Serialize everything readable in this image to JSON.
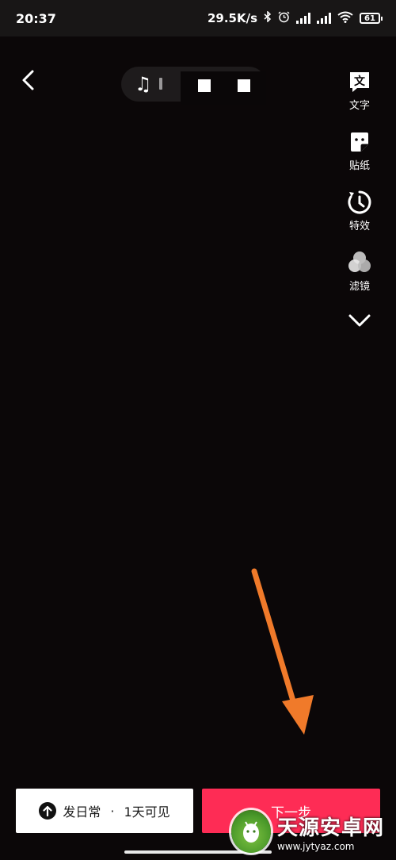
{
  "status_bar": {
    "time": "20:37",
    "speed": "29.5K/s",
    "battery": "61",
    "icons": [
      "bluetooth-icon",
      "alarm-icon",
      "signal-icon",
      "hd-signal-icon",
      "wifi-icon",
      "battery-icon"
    ]
  },
  "top_bar": {
    "back_icon": "chevron-left-icon",
    "music_icon": "music-note-icon"
  },
  "side_tools": [
    {
      "label": "文字",
      "icon": "text-icon"
    },
    {
      "label": "贴纸",
      "icon": "sticker-icon"
    },
    {
      "label": "特效",
      "icon": "effects-timer-icon"
    },
    {
      "label": "滤镜",
      "icon": "filter-icon"
    }
  ],
  "expand_icon": "chevron-down-icon",
  "annotation": {
    "color": "#f07a2a"
  },
  "bottom": {
    "publish_label": "发日常",
    "separator": "·",
    "visibility_label": "1天可见",
    "next_label": "下一步",
    "next_color": "#fe2c55"
  },
  "watermark": {
    "title": "天源安卓网",
    "url": "www.jytyaz.com"
  }
}
